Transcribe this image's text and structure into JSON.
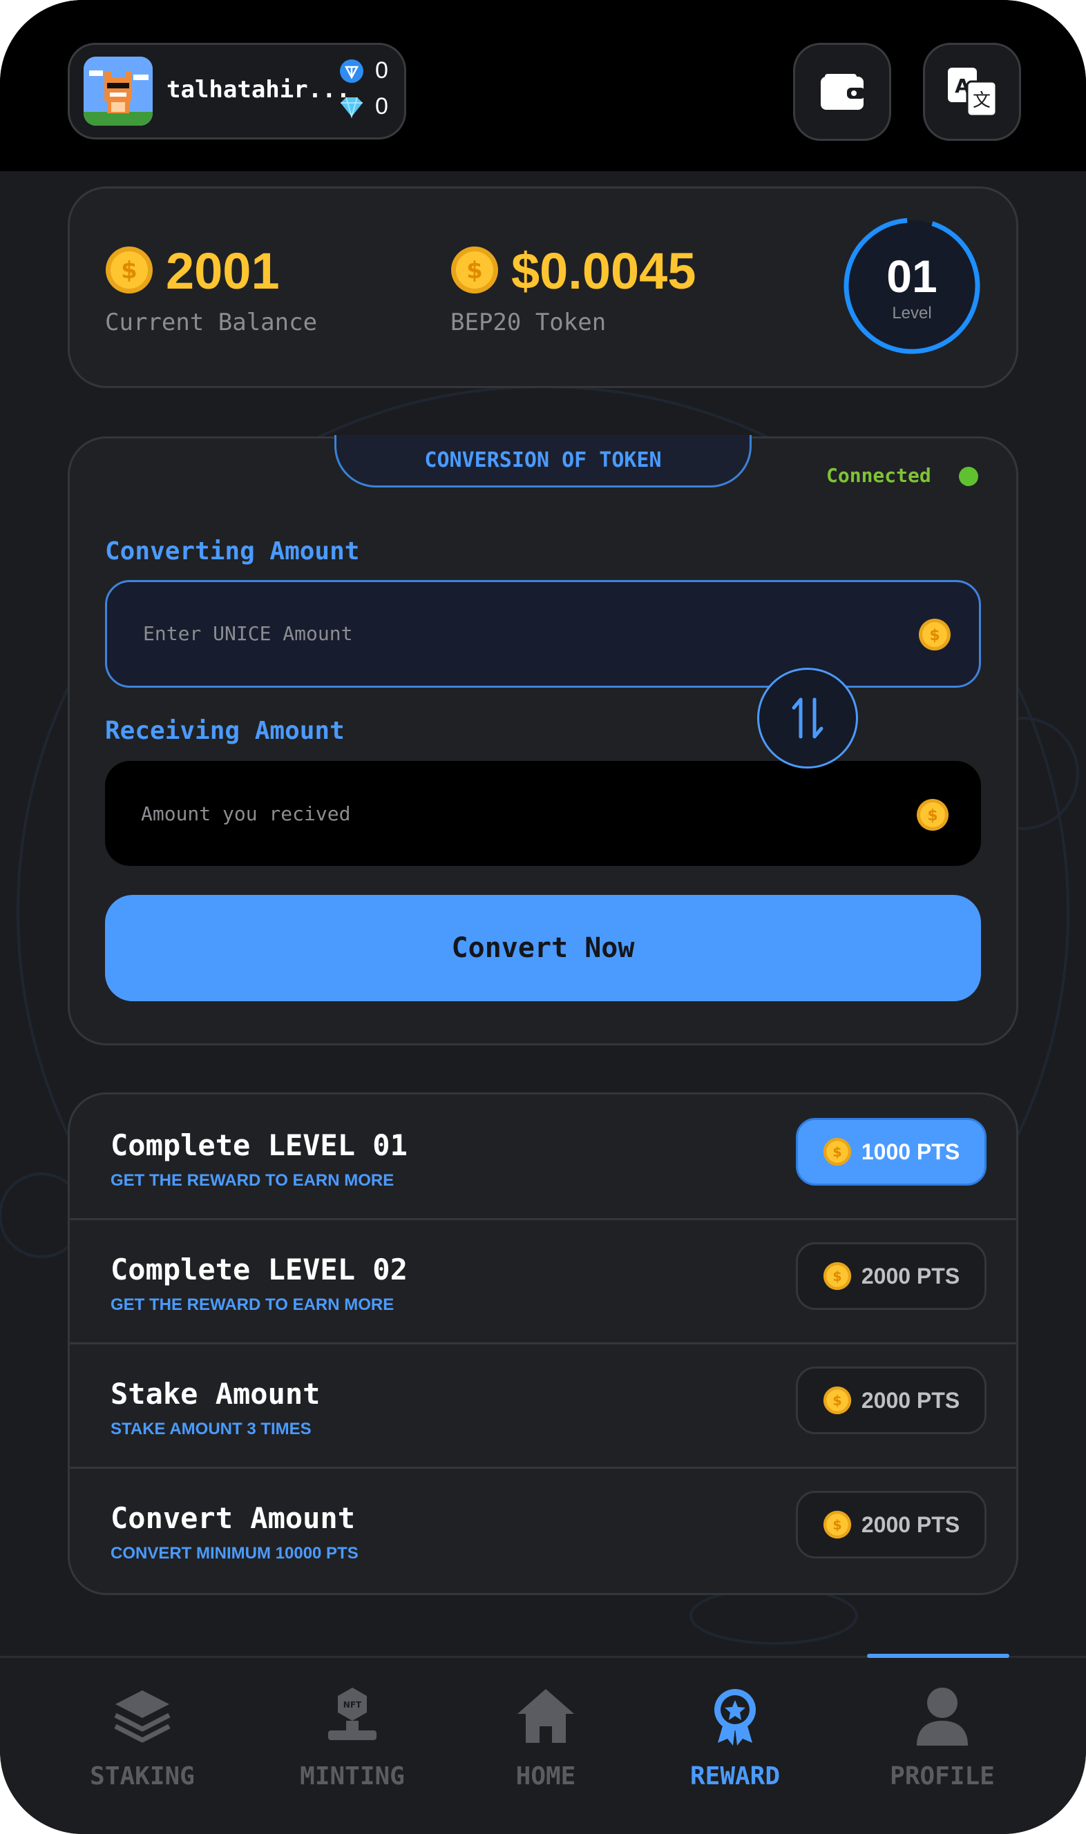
{
  "header": {
    "username": "talhatahir...",
    "ton_count": "0",
    "gem_count": "0",
    "wallet_icon": "wallet-icon",
    "translate_icon": "translate-icon"
  },
  "balance": {
    "current_value": "2001",
    "current_label": "Current Balance",
    "token_value": "$0.0045",
    "token_label": "BEP20 Token",
    "level_value": "01",
    "level_label": "Level"
  },
  "conversion": {
    "tab_title": "CONVERSION OF TOKEN",
    "status": "Connected",
    "converting_label": "Converting Amount",
    "converting_placeholder": "Enter UNICE Amount",
    "receiving_label": "Receiving Amount",
    "receiving_placeholder": "Amount you recived",
    "convert_button": "Convert Now"
  },
  "tasks": [
    {
      "title": "Complete LEVEL 01",
      "subtitle": "GET THE REWARD TO EARN MORE",
      "points": "1000 PTS",
      "active": true
    },
    {
      "title": "Complete LEVEL 02",
      "subtitle": "GET THE REWARD TO EARN MORE",
      "points": "2000 PTS",
      "active": false
    },
    {
      "title": "Stake Amount",
      "subtitle": "STAKE AMOUNT 3 TIMES",
      "points": "2000 PTS",
      "active": false
    },
    {
      "title": "Convert Amount",
      "subtitle": "CONVERT MINIMUM 10000 PTS",
      "points": "2000 PTS",
      "active": false
    }
  ],
  "nav": {
    "items": [
      {
        "label": "STAKING",
        "icon": "stack-icon"
      },
      {
        "label": "MINTING",
        "icon": "nft-minting-icon"
      },
      {
        "label": "HOME",
        "icon": "home-icon"
      },
      {
        "label": "REWARD",
        "icon": "reward-badge-icon"
      },
      {
        "label": "PROFILE",
        "icon": "profile-icon"
      }
    ],
    "active_index": 3
  },
  "colors": {
    "accent": "#4b9bff",
    "gold": "#ffc531",
    "connected": "#5fc12f",
    "background": "#1b1c1f"
  }
}
